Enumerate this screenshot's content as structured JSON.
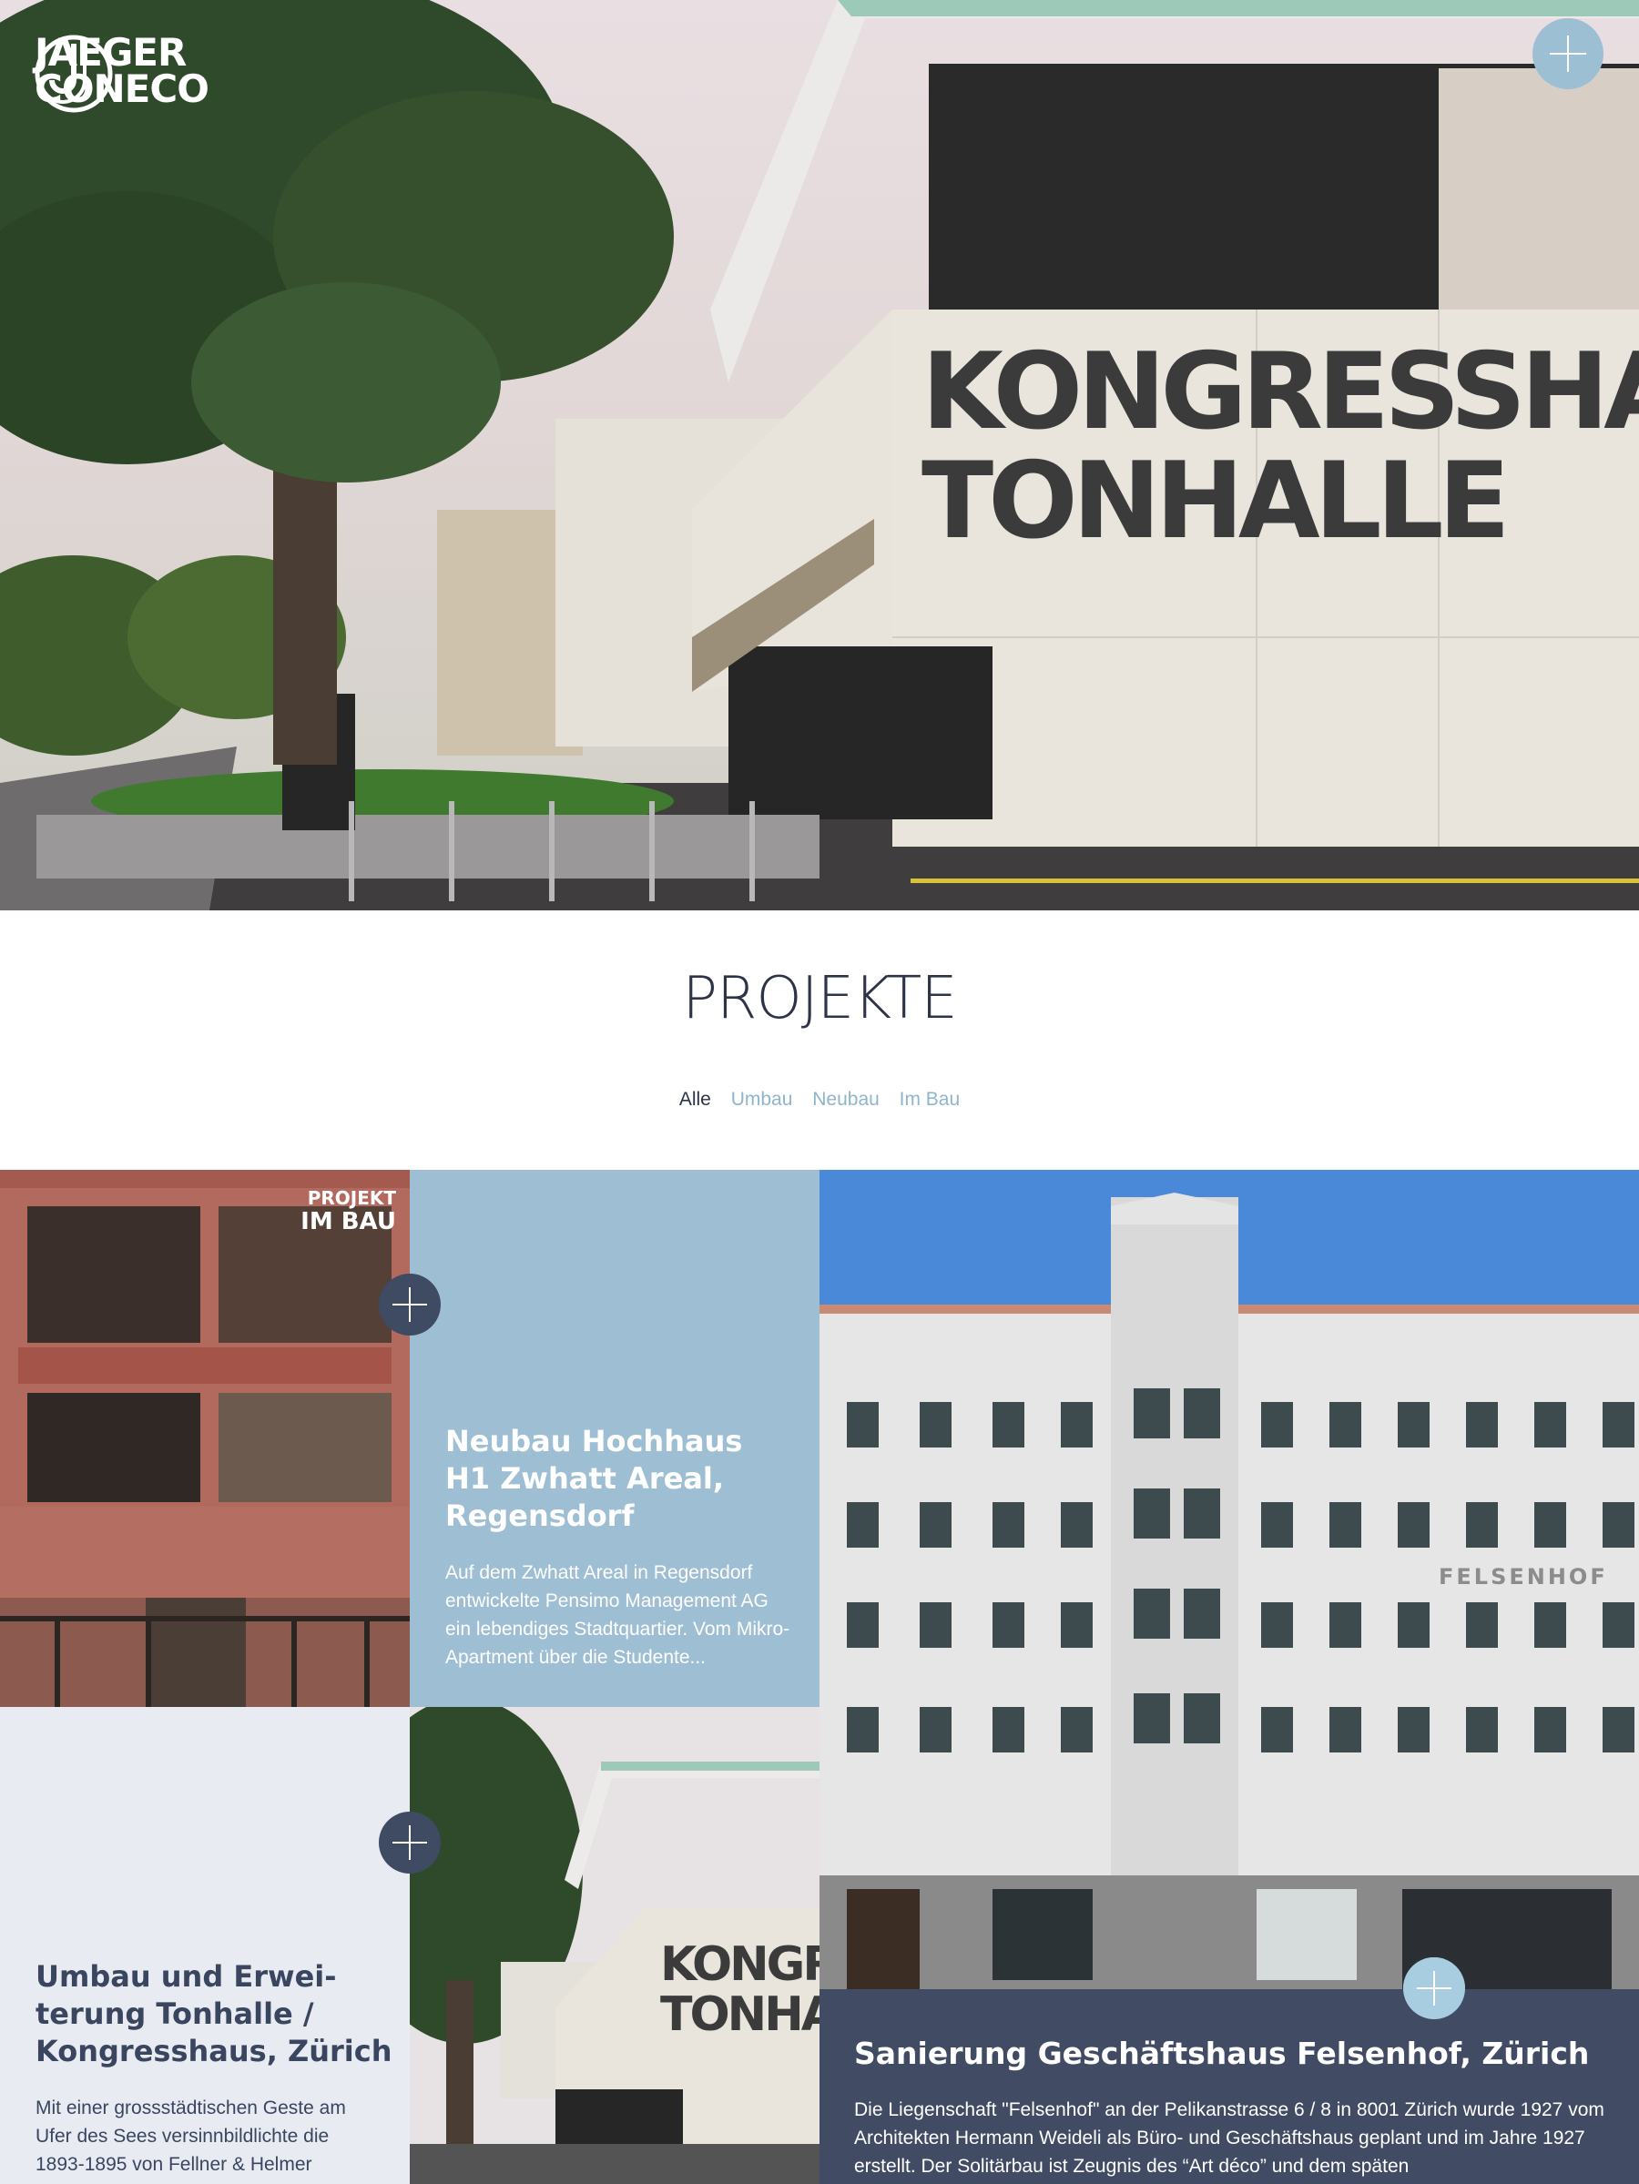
{
  "brand": {
    "line1": "JAEGER",
    "line2": "CONECO"
  },
  "hero": {
    "sign_line1": "KONGRESSHAUS",
    "sign_line2": "TONHALLE"
  },
  "section": {
    "title": "PROJEKTE"
  },
  "filters": [
    {
      "label": "Alle",
      "active": true
    },
    {
      "label": "Umbau",
      "active": false
    },
    {
      "label": "Neubau",
      "active": false
    },
    {
      "label": "Im Bau",
      "active": false
    }
  ],
  "projects": [
    {
      "badge_line1": "PROJEKT",
      "badge_line2": "IM BAU",
      "title": "Neubau Hochhaus H1 Zwhatt Areal, Regensdorf",
      "excerpt": "Auf dem Zwhatt Areal in Regensdorf entwickelte Pensimo Management AG ein lebendiges Stadtquartier. Vom Mikro-Apartment über die Studente..."
    },
    {
      "title": "Umbau und Erwei-terung Tonhalle / Kongresshaus, Zürich",
      "excerpt": "Mit einer grossstädtischen Geste am Ufer des Sees versinnbildlichte die 1893-1895 von Fellner & Helmer",
      "image_sign_line1": "KONGRES",
      "image_sign_line2": "TONHALL"
    },
    {
      "title": "Sanierung Geschäftshaus Felsenhof, Zürich",
      "excerpt": "Die Liegenschaft \"Felsenhof\" an der Pelikanstrasse 6 / 8 in 8001 Zürich wurde 1927 vom Architekten Hermann Weideli als Büro- und Geschäftshaus geplant und im Jahre 1927 erstellt. Der Solitärbau ist Zeugnis des “Art déco” und dem späten",
      "facade_label": "FELSENHOF"
    }
  ],
  "colors": {
    "navy": "#2d3447",
    "card_blue": "#9ebfd3",
    "card_light": "#e8ebf1",
    "card_dark": "#414b63",
    "filter_inactive": "#8fb5cc",
    "plus_light": "#9dbfd3"
  },
  "icons": {
    "hero_button": "plus-icon",
    "card_button": "plus-icon",
    "logo": "jaeger-coneco-logo-mark"
  }
}
